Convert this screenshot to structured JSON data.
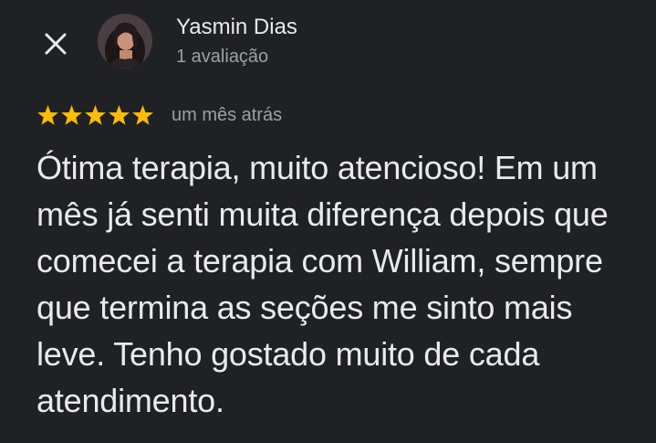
{
  "header": {
    "close_icon": "close-icon",
    "reviewer_name": "Yasmin Dias",
    "reviewer_review_count": "1 avaliação",
    "avatar_icon": "profile-photo"
  },
  "review": {
    "rating": 5,
    "rating_max": 5,
    "star_color": "#fbbc04",
    "date": "um mês atrás",
    "text": "Ótima terapia, muito atencioso! Em um mês já senti muita diferença depois que comecei a terapia com William, sempre que termina as seções me sinto mais leve. Tenho gostado muito de cada atendimento."
  },
  "colors": {
    "background": "#202124",
    "primary_text": "#e8eaed",
    "secondary_text": "#9aa0a6"
  }
}
